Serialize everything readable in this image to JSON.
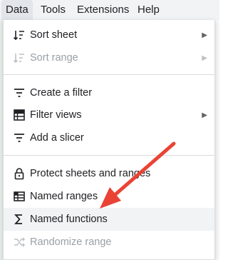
{
  "menubar": {
    "items": [
      "Data",
      "Tools",
      "Extensions",
      "Help"
    ],
    "active": "Data"
  },
  "menu": {
    "items": [
      {
        "label": "Sort sheet",
        "icon": "sort-icon",
        "submenu": true,
        "disabled": false
      },
      {
        "label": "Sort range",
        "icon": "sort-icon",
        "submenu": true,
        "disabled": true
      },
      {
        "label": "Create a filter",
        "icon": "filter-icon",
        "submenu": false,
        "disabled": false
      },
      {
        "label": "Filter views",
        "icon": "filter-views-icon",
        "submenu": true,
        "disabled": false
      },
      {
        "label": "Add a slicer",
        "icon": "slicer-icon",
        "submenu": false,
        "disabled": false
      },
      {
        "label": "Protect sheets and ranges",
        "icon": "lock-icon",
        "submenu": false,
        "disabled": false
      },
      {
        "label": "Named ranges",
        "icon": "named-ranges-icon",
        "submenu": false,
        "disabled": false
      },
      {
        "label": "Named functions",
        "icon": "sigma-icon",
        "submenu": false,
        "disabled": false,
        "highlighted": true
      },
      {
        "label": "Randomize range",
        "icon": "randomize-icon",
        "submenu": false,
        "disabled": true
      }
    ],
    "chevron": "▶"
  },
  "annotation": {
    "color": "#ea4335",
    "points_to": "Named functions"
  }
}
